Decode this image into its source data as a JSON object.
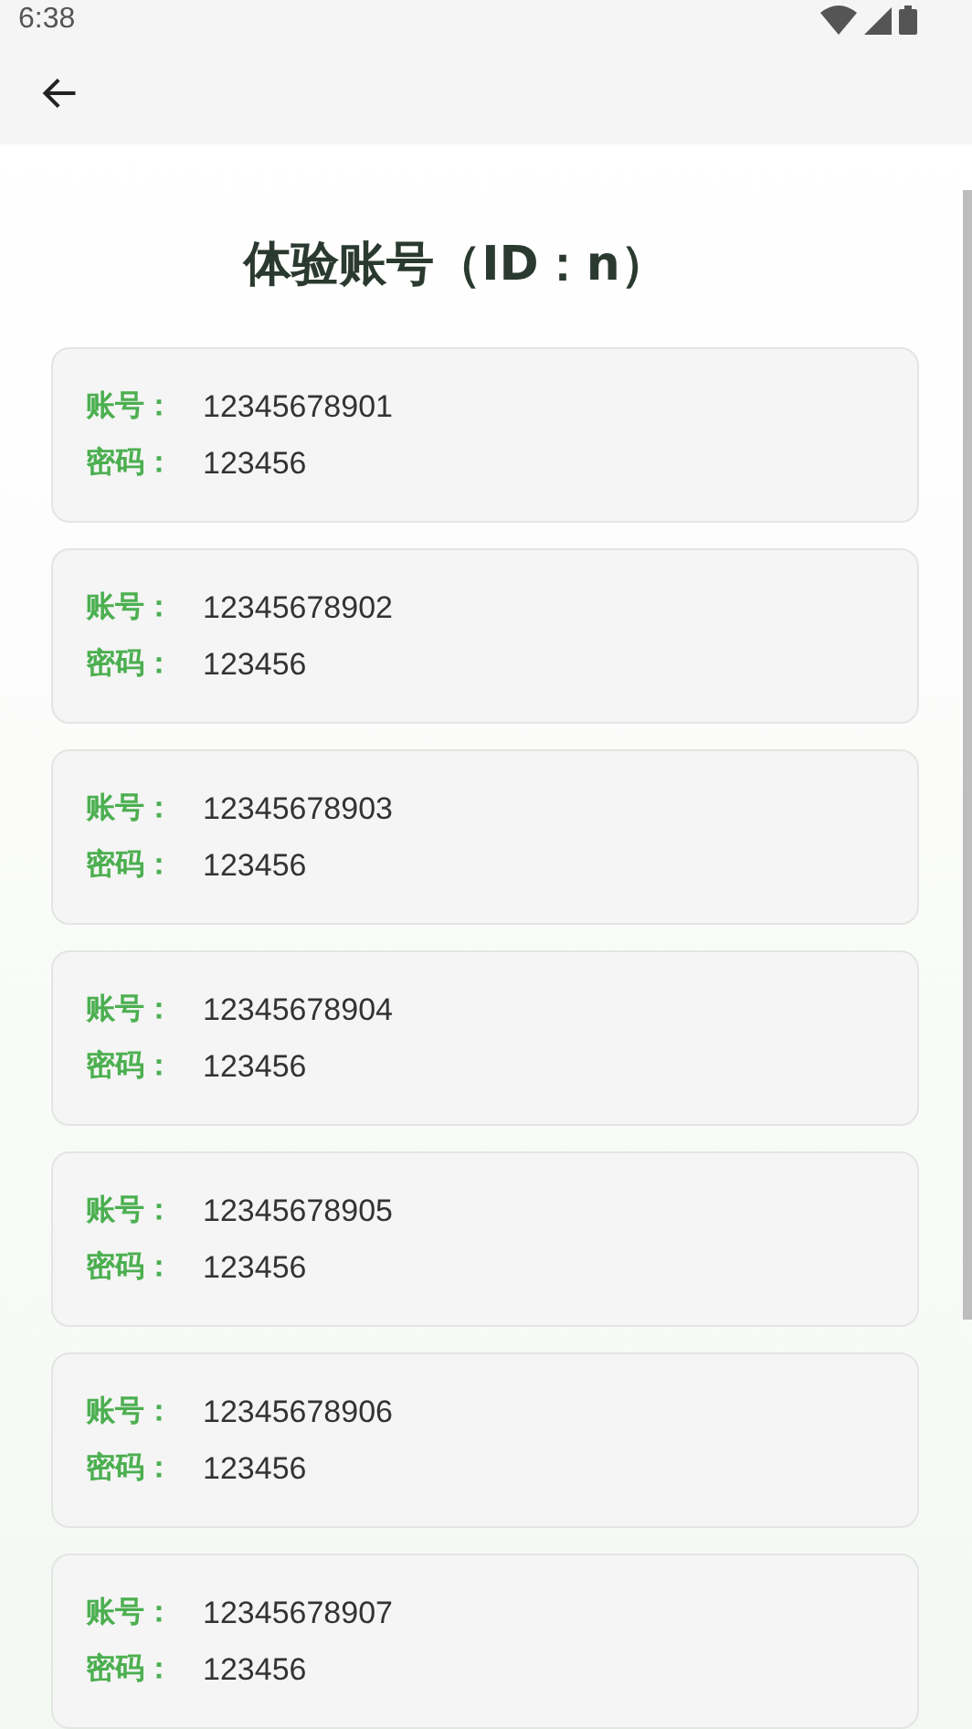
{
  "status_bar": {
    "time": "6:38"
  },
  "title": "体验账号（ID：n）",
  "accounts": [
    {
      "account_label": "账号：",
      "account": "12345678901",
      "password_label": "密码：",
      "password": "123456"
    },
    {
      "account_label": "账号：",
      "account": "12345678902",
      "password_label": "密码：",
      "password": "123456"
    },
    {
      "account_label": "账号：",
      "account": "12345678903",
      "password_label": "密码：",
      "password": "123456"
    },
    {
      "account_label": "账号：",
      "account": "12345678904",
      "password_label": "密码：",
      "password": "123456"
    },
    {
      "account_label": "账号：",
      "account": "12345678905",
      "password_label": "密码：",
      "password": "123456"
    },
    {
      "account_label": "账号：",
      "account": "12345678906",
      "password_label": "密码：",
      "password": "123456"
    },
    {
      "account_label": "账号：",
      "account": "12345678907",
      "password_label": "密码：",
      "password": "123456"
    }
  ]
}
